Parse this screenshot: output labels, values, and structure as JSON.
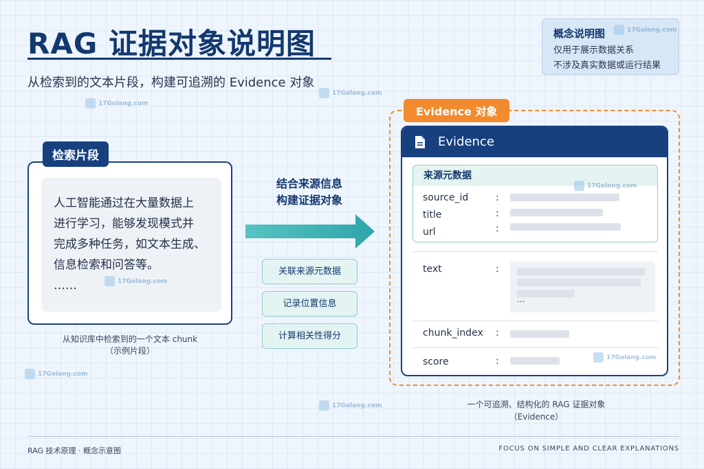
{
  "header": {
    "title": "RAG 证据对象说明图",
    "subtitle": "从检索到的文本片段，构建可追溯的 Evidence 对象"
  },
  "concept_box": {
    "title": "概念说明图",
    "lines": [
      "仅用于展示数据关系",
      "不涉及真实数据或运行结果"
    ]
  },
  "left": {
    "tag": "检索片段",
    "chunk_lines": [
      "人工智能通过在大量数据上",
      "进行学习，能够发现模式并",
      "完成多种任务，如文本生成、",
      "信息检索和问答等。",
      "……"
    ],
    "caption_lines": [
      "从知识库中检索到的一个文本 chunk",
      "（示例片段）"
    ]
  },
  "middle": {
    "label_lines": [
      "结合来源信息",
      "构建证据对象"
    ],
    "steps": [
      "关联来源元数据",
      "记录位置信息",
      "计算相关性得分"
    ]
  },
  "evidence": {
    "tag": "Evidence 对象",
    "header": "Evidence",
    "meta_title": "来源元数据",
    "meta_fields": [
      "source_id",
      "title",
      "url"
    ],
    "colon": ":",
    "text_field": "text",
    "text_ellipsis": "...",
    "chunk_index_field": "chunk_index",
    "score_field": "score",
    "caption_lines": [
      "一个可追溯、结构化的 RAG 证据对象",
      "（Evidence）"
    ]
  },
  "footer": {
    "left": "RAG 技术原理 · 概念示意图",
    "right": "FOCUS ON SIMPLE AND CLEAR EXPLANATIONS"
  },
  "watermark": {
    "text": "17Golang.com"
  },
  "colors": {
    "navy": "#17407f",
    "orange": "#f28a2e",
    "teal": "#3ab0b0",
    "background": "#eef5fc"
  }
}
